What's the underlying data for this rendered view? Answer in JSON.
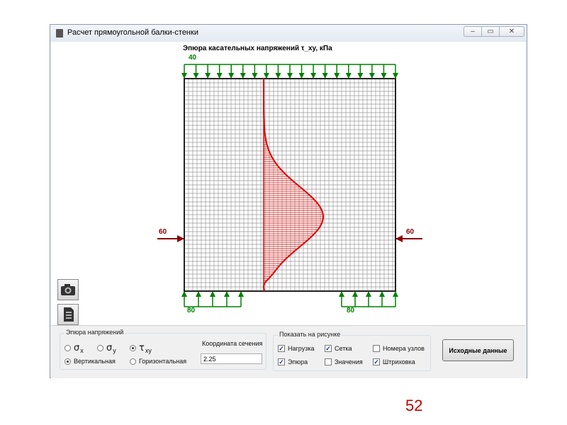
{
  "window": {
    "title": "Расчет прямоугольной балки-стенки",
    "controls": {
      "minimize": "–",
      "maximize": "▭",
      "close": "✕"
    }
  },
  "plot": {
    "title": "Эпюра касательных напряжений τ_xy, кПа",
    "top_load": "40",
    "left_load": "60",
    "right_load": "60",
    "bottom_left_load": "80",
    "bottom_right_load": "80",
    "colors": {
      "epure": "#e00000",
      "arrows": "#008000",
      "side_arrows": "#8b0000",
      "grid": "#9a9a9a"
    }
  },
  "side_buttons": [
    {
      "icon": "camera-icon"
    },
    {
      "icon": "document-icon"
    }
  ],
  "stress_group": {
    "label": "Эпюра напряжений",
    "options": [
      {
        "symbol": "σ",
        "sub": "x",
        "checked": false
      },
      {
        "symbol": "σ",
        "sub": "y",
        "checked": false
      },
      {
        "symbol": "τ",
        "sub": "xy",
        "checked": true
      }
    ],
    "orientation": [
      {
        "label": "Вертикальная",
        "checked": true
      },
      {
        "label": "Горизонтальная",
        "checked": false
      }
    ]
  },
  "section": {
    "label": "Координата сечения",
    "value": "2.25"
  },
  "show_group": {
    "label": "Показать на рисунке",
    "items": [
      {
        "label": "Нагрузка",
        "checked": true
      },
      {
        "label": "Сетка",
        "checked": true
      },
      {
        "label": "Номера узлов",
        "checked": false
      },
      {
        "label": "Эпюра",
        "checked": true
      },
      {
        "label": "Значения",
        "checked": false
      },
      {
        "label": "Штриховка",
        "checked": true
      }
    ]
  },
  "initial_data_button": "Исходные данные",
  "page_number": "52"
}
